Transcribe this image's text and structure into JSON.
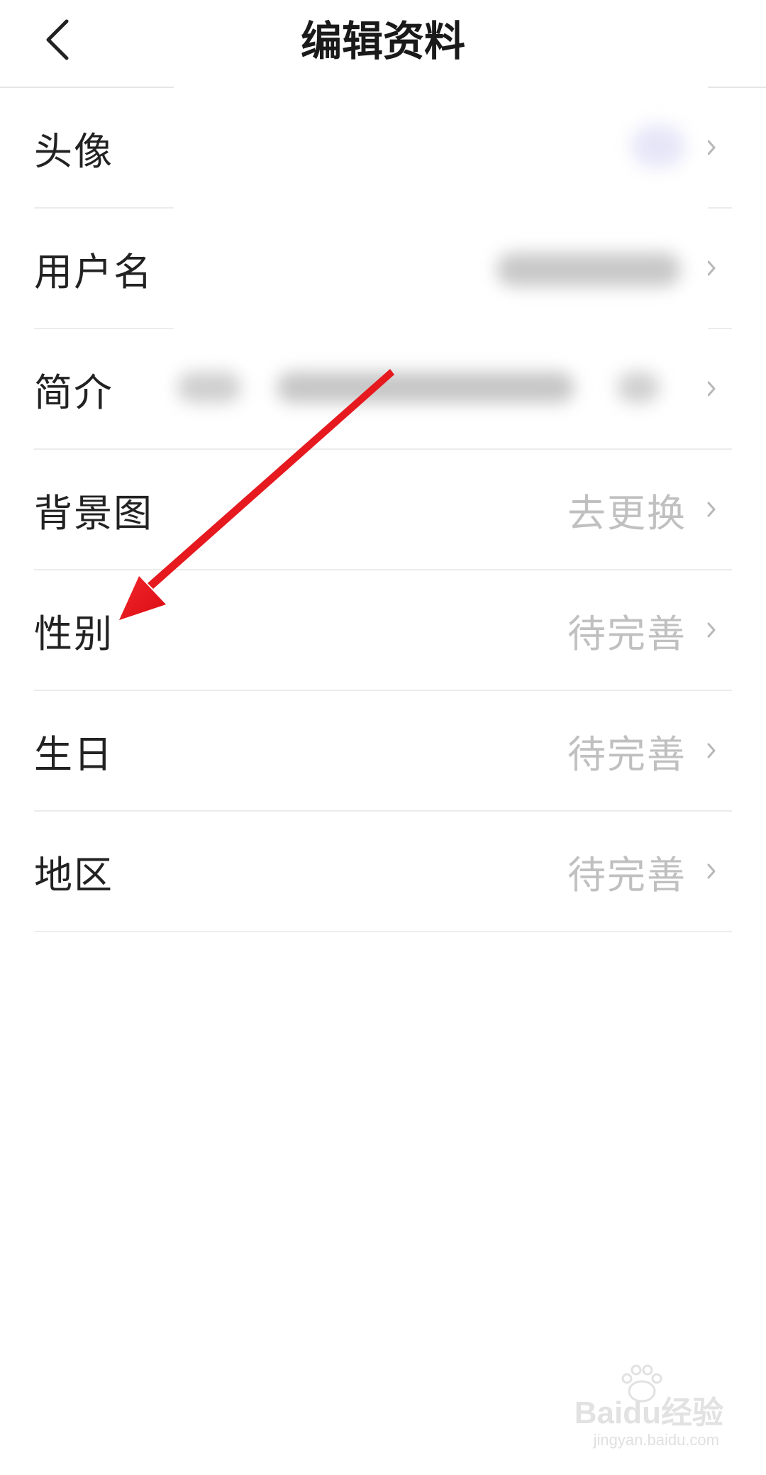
{
  "header": {
    "title": "编辑资料",
    "back_icon": "chevron-left-icon"
  },
  "rows": [
    {
      "label": "头像",
      "value": "",
      "chevron": "chevron-right-icon"
    },
    {
      "label": "用户名",
      "value": "",
      "chevron": "chevron-right-icon"
    },
    {
      "label": "简介",
      "value": "",
      "chevron": "chevron-right-icon"
    },
    {
      "label": "背景图",
      "value": "去更换",
      "chevron": "chevron-right-icon"
    },
    {
      "label": "性别",
      "value": "待完善",
      "chevron": "chevron-right-icon"
    },
    {
      "label": "生日",
      "value": "待完善",
      "chevron": "chevron-right-icon"
    },
    {
      "label": "地区",
      "value": "待完善",
      "chevron": "chevron-right-icon"
    }
  ],
  "annotation": {
    "arrow_color": "#e8141b"
  },
  "watermark": {
    "brand": "Baidu经验",
    "url": "jingyan.baidu.com"
  }
}
